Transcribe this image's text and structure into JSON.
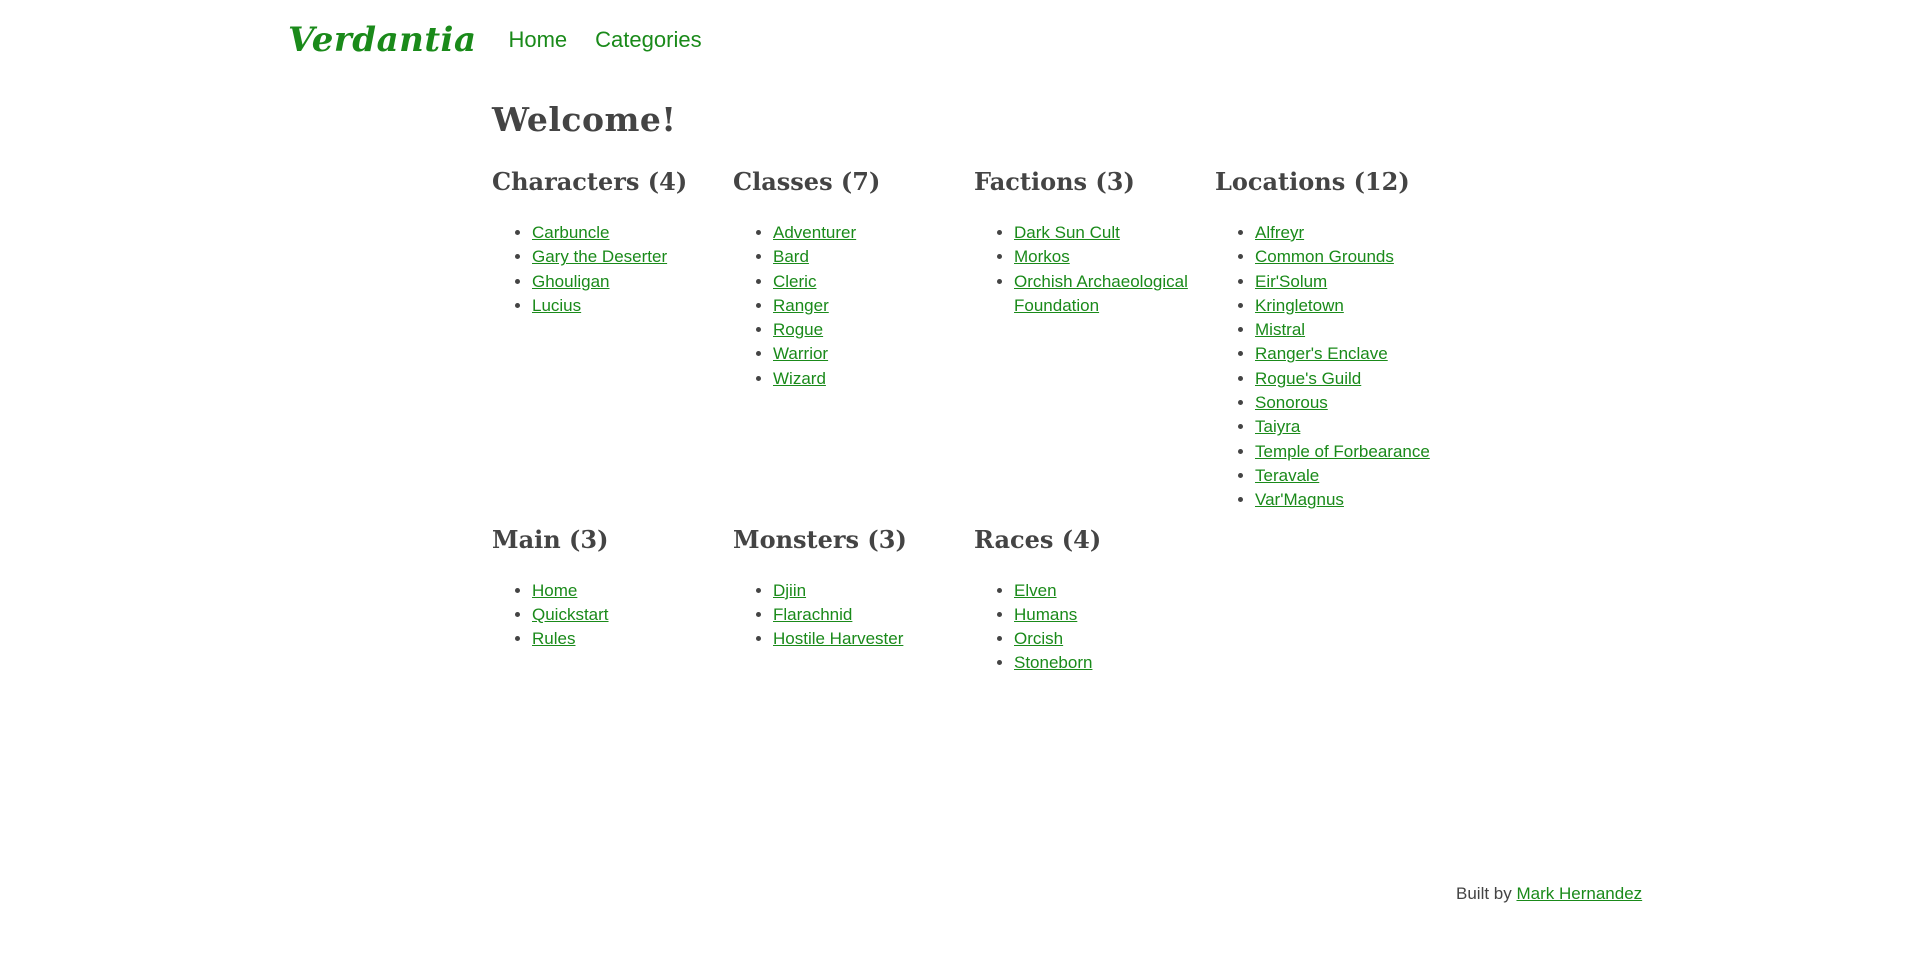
{
  "header": {
    "brand": "Verdantia",
    "nav": [
      {
        "label": "Home"
      },
      {
        "label": "Categories"
      }
    ]
  },
  "main": {
    "title": "Welcome!",
    "categories": [
      {
        "heading": "Characters (4)",
        "items": [
          "Carbuncle",
          "Gary the Deserter",
          "Ghouligan",
          "Lucius"
        ]
      },
      {
        "heading": "Classes (7)",
        "items": [
          "Adventurer",
          "Bard",
          "Cleric",
          "Ranger",
          "Rogue",
          "Warrior",
          "Wizard"
        ]
      },
      {
        "heading": "Factions (3)",
        "items": [
          "Dark Sun Cult",
          "Morkos",
          "Orchish Archaeological Foundation"
        ]
      },
      {
        "heading": "Locations (12)",
        "items": [
          "Alfreyr",
          "Common Grounds",
          "Eir'Solum",
          "Kringletown",
          "Mistral",
          "Ranger's Enclave",
          "Rogue's Guild",
          "Sonorous",
          "Taiyra",
          "Temple of Forbearance",
          "Teravale",
          "Var'Magnus"
        ]
      },
      {
        "heading": "Main (3)",
        "items": [
          "Home",
          "Quickstart",
          "Rules"
        ]
      },
      {
        "heading": "Monsters (3)",
        "items": [
          "Djiin",
          "Flarachnid",
          "Hostile Harvester"
        ]
      },
      {
        "heading": "Races (4)",
        "items": [
          "Elven",
          "Humans",
          "Orcish",
          "Stoneborn"
        ]
      }
    ]
  },
  "footer": {
    "prefix": "Built by",
    "author": "Mark Hernandez"
  },
  "colors": {
    "link": "#1a8a1a",
    "text": "#444444",
    "background": "#ffffff"
  }
}
